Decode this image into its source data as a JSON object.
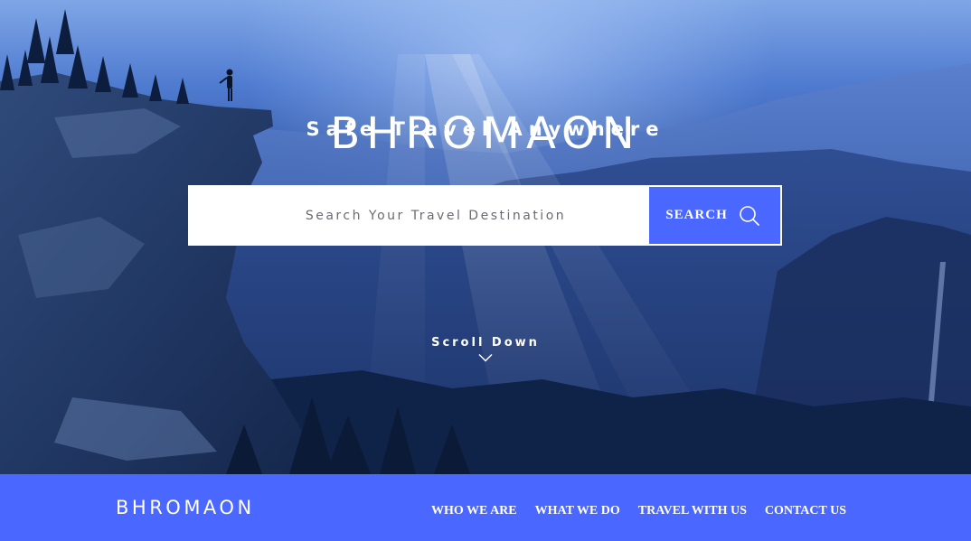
{
  "hero": {
    "title": "BHROMAON",
    "subtitle": "Safe Travel Anywhere"
  },
  "search": {
    "placeholder": "Search Your Travel Destination",
    "value": "",
    "button_label": "SEARCH",
    "button_icon": "search-icon"
  },
  "scroll": {
    "label": "Scroll Down",
    "icon": "chevron-down-icon"
  },
  "navbar": {
    "logo": "BHROMAON",
    "links": [
      {
        "label": "WHO WE ARE"
      },
      {
        "label": "WHAT WE DO"
      },
      {
        "label": "TRAVEL WITH US"
      },
      {
        "label": "CONTACT US"
      }
    ]
  },
  "colors": {
    "accent": "#4a67ff",
    "text_light": "#ffffff",
    "placeholder_text": "#6a6a74"
  }
}
